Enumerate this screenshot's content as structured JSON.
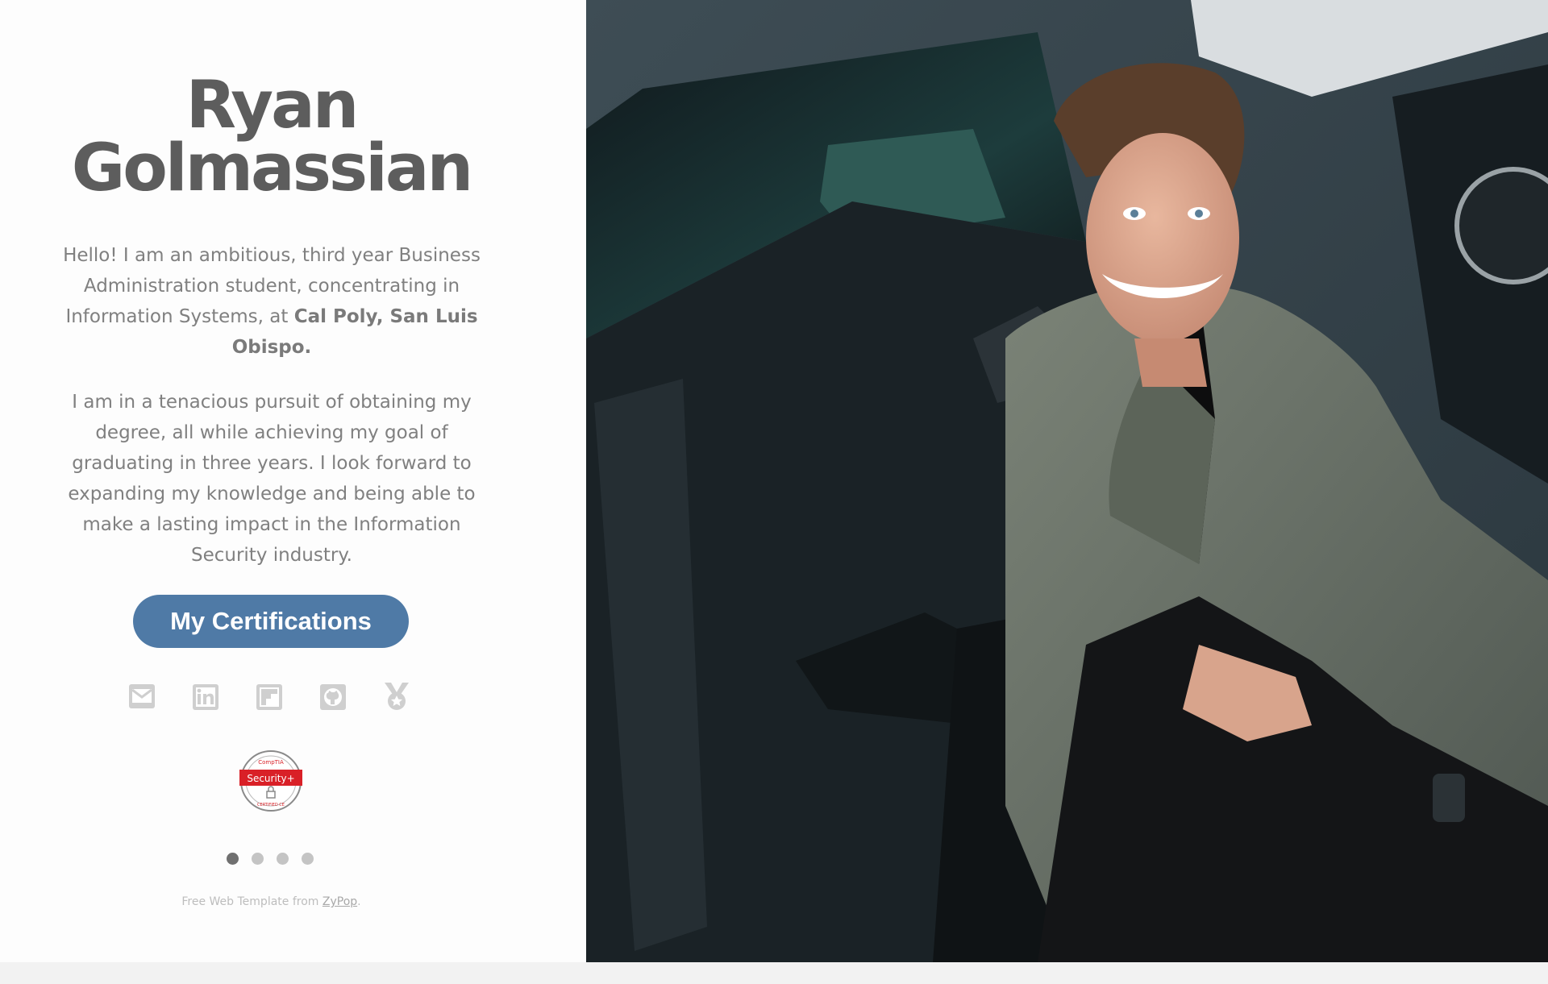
{
  "profile": {
    "first_name": "Ryan",
    "last_name": "Golmassian"
  },
  "bio": {
    "p1_start": "Hello! I am an ambitious, third year Business Administration student, concentrating in Information Systems, at ",
    "p1_bold": "Cal Poly, San Luis Obispo.",
    "p2": "I am in a tenacious pursuit of obtaining my degree, all while achieving my goal of graduating in three years. I look forward to expanding my knowledge and being able to make a lasting impact in the Information Security industry."
  },
  "actions": {
    "certifications_label": "My Certifications"
  },
  "social": [
    "mail-icon",
    "linkedin-icon",
    "flipboard-icon",
    "github-icon",
    "medal-icon"
  ],
  "badge": {
    "top": "CompTIA",
    "label": "Security+",
    "bottom": "CERTIFIED CE"
  },
  "slider": {
    "count": 4,
    "active_index": 0
  },
  "footer": {
    "text": "Free Web Template from ",
    "link": "ZyPop",
    "suffix": "."
  },
  "colors": {
    "button": "#4f7aa6",
    "heading": "#5d5d5d",
    "body_text": "#808080",
    "badge_red": "#d92027"
  }
}
